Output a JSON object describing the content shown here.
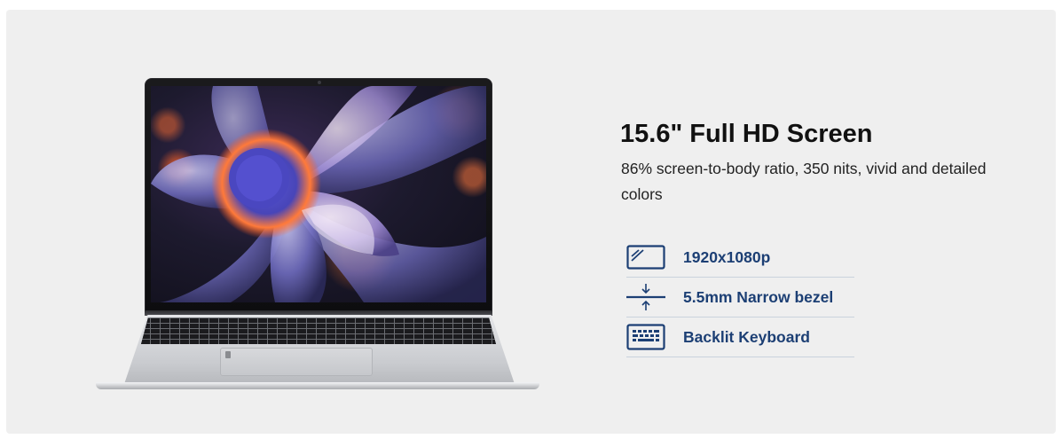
{
  "product": {
    "title": "15.6\" Full HD Screen",
    "description": "86% screen-to-body ratio, 350 nits, vivid and detailed colors"
  },
  "features": [
    {
      "icon": "screen-resolution-icon",
      "label": "1920x1080p"
    },
    {
      "icon": "narrow-bezel-icon",
      "label": "5.5mm Narrow bezel"
    },
    {
      "icon": "backlit-keyboard-icon",
      "label": "Backlit Keyboard"
    }
  ],
  "colors": {
    "background": "#efefef",
    "accent": "#1c3f74",
    "title": "#111111",
    "divider": "#c9d2dd"
  }
}
